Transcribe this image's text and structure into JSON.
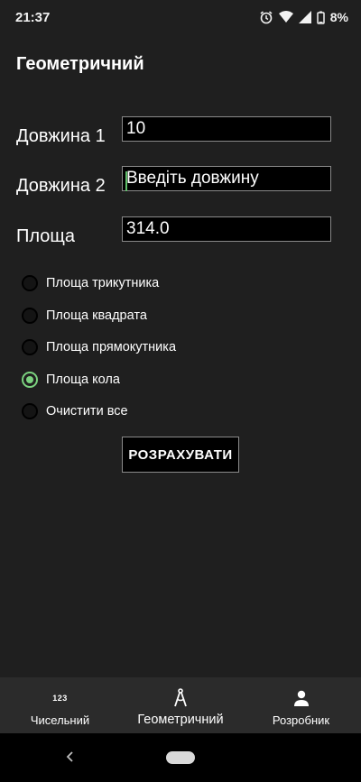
{
  "status": {
    "time": "21:37",
    "battery": "8%"
  },
  "app": {
    "title": "Геометричний"
  },
  "form": {
    "length1_label": "Довжина 1",
    "length1_value": "10",
    "length2_label": "Довжина 2",
    "length2_value": "",
    "length2_placeholder": "Введіть довжину",
    "area_label": "Площа",
    "area_value": "314.0"
  },
  "options": [
    {
      "label": "Площа трикутника",
      "checked": false
    },
    {
      "label": "Площа квадрата",
      "checked": false
    },
    {
      "label": "Площа прямокутника",
      "checked": false
    },
    {
      "label": "Площа кола",
      "checked": true
    },
    {
      "label": "Очистити все",
      "checked": false
    }
  ],
  "calculate_label": "РОЗРАХУВАТИ",
  "bottom_nav": {
    "numeric": {
      "icon": "123",
      "label": "Чисельний"
    },
    "geometric": {
      "label": "Геометричний",
      "active": true
    },
    "developer": {
      "label": "Розробник"
    }
  },
  "colors": {
    "accent": "#7bd27f",
    "background": "#1f1f1f",
    "field_bg": "#000000"
  }
}
